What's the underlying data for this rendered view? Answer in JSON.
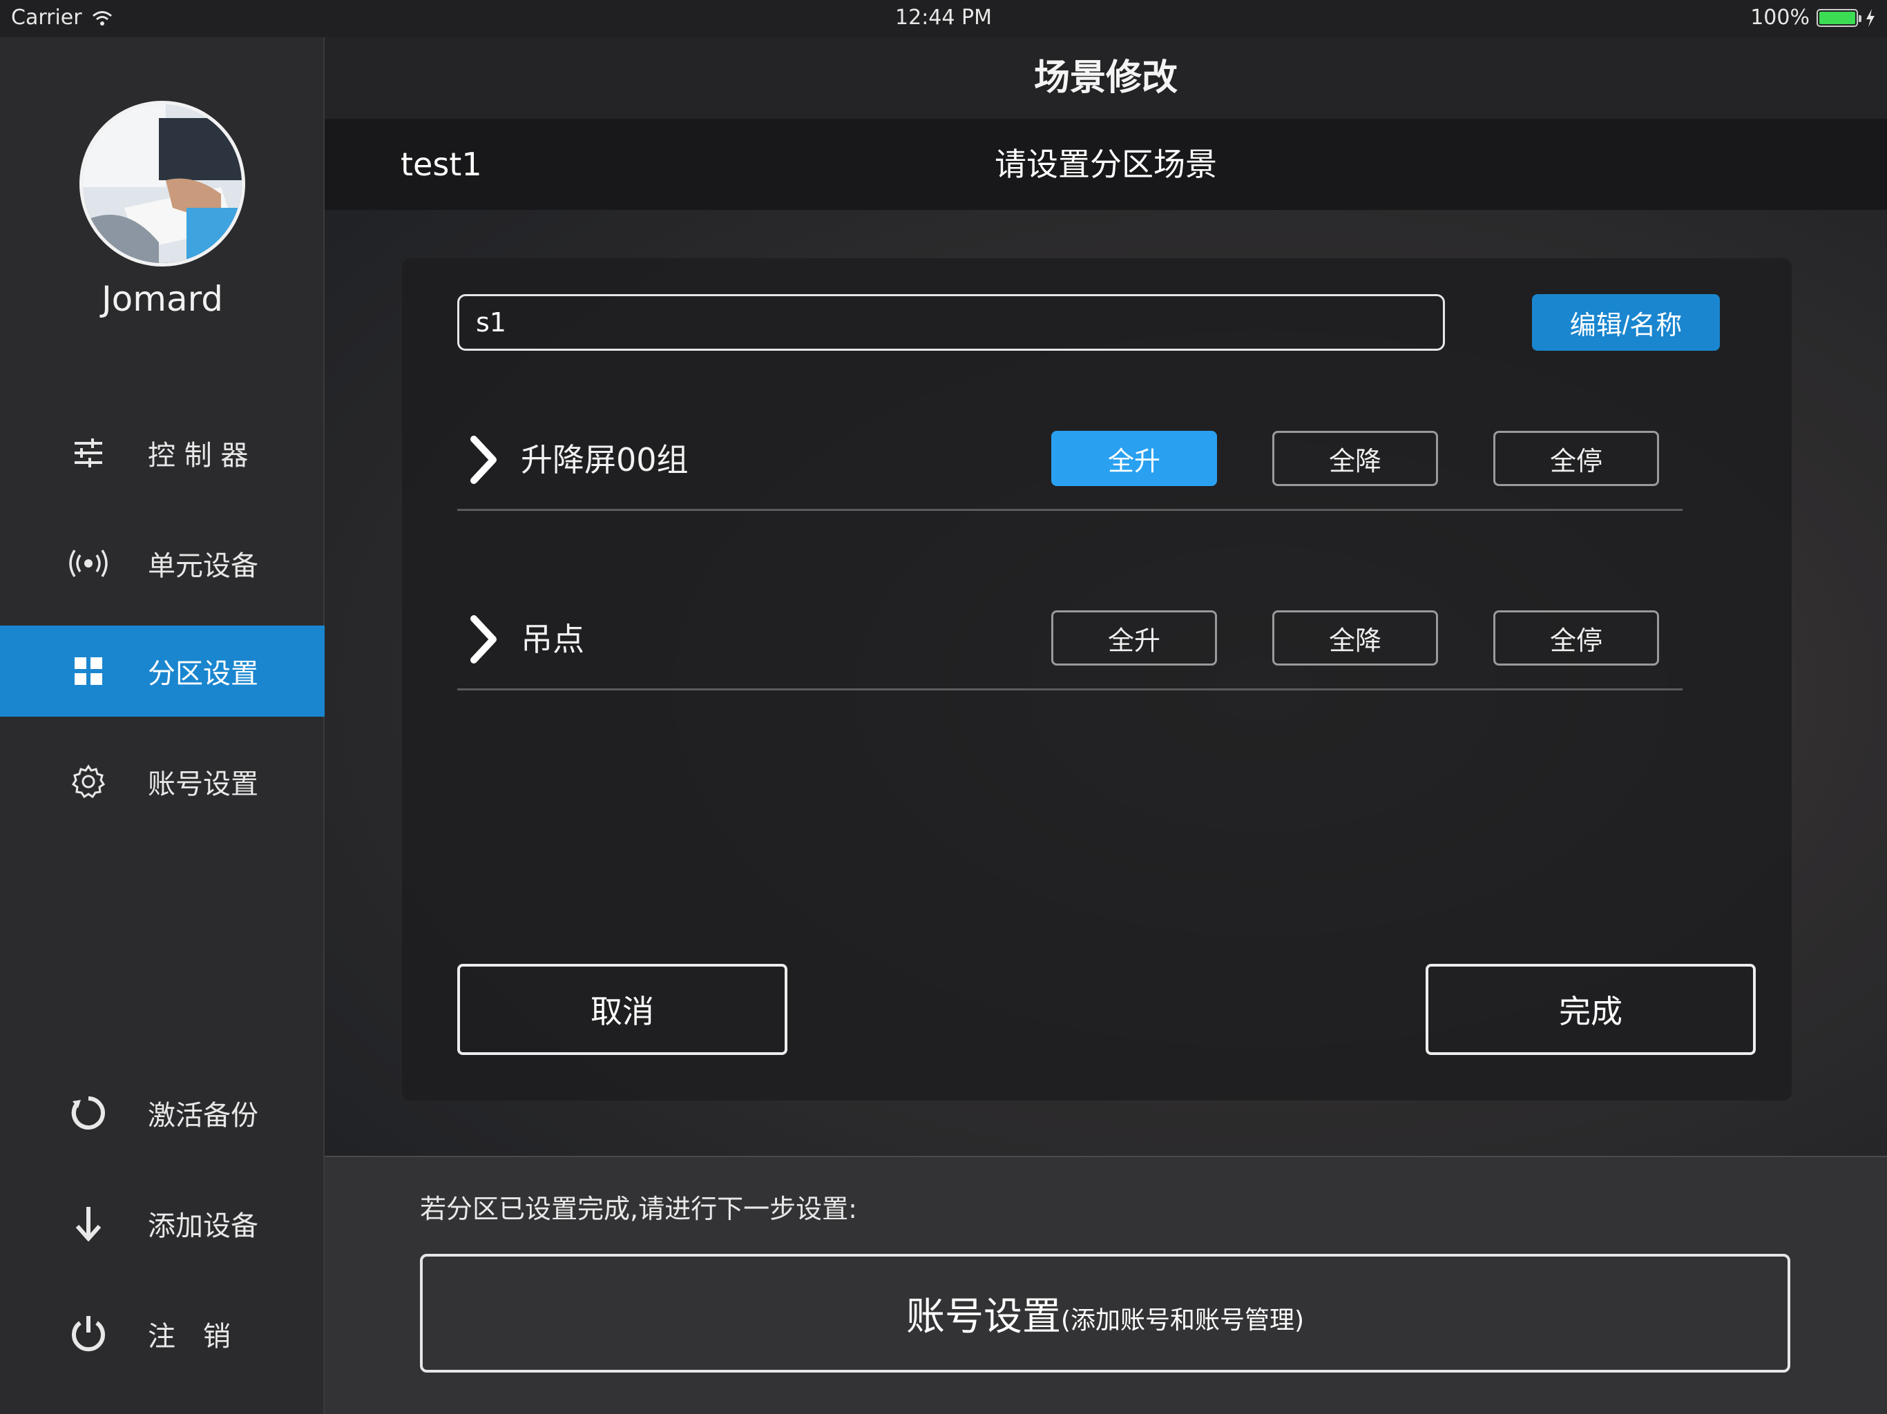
{
  "status_bar": {
    "carrier": "Carrier",
    "time": "12:44 PM",
    "battery": "100%"
  },
  "sidebar": {
    "username": "Jomard",
    "items": [
      {
        "label": "控 制 器",
        "icon": "sliders-icon",
        "active": false
      },
      {
        "label": "单元设备",
        "icon": "broadcast-icon",
        "active": false
      },
      {
        "label": "分区设置",
        "icon": "grid-icon",
        "active": true
      },
      {
        "label": "账号设置",
        "icon": "gear-icon",
        "active": false
      },
      {
        "label": "激活备份",
        "icon": "refresh-icon",
        "active": false
      },
      {
        "label": "添加设备",
        "icon": "arrow-down-icon",
        "active": false
      },
      {
        "label": "注　销",
        "icon": "power-icon",
        "active": false
      }
    ]
  },
  "header": {
    "title": "场景修改"
  },
  "subheader": {
    "scene": "test1",
    "hint": "请设置分区场景"
  },
  "panel": {
    "name_input_value": "s1",
    "edit_name_label": "编辑/名称",
    "groups": [
      {
        "name": "升降屏00组",
        "actions": [
          "全升",
          "全降",
          "全停"
        ],
        "selected": "全升"
      },
      {
        "name": "吊点",
        "actions": [
          "全升",
          "全降",
          "全停"
        ],
        "selected": null
      }
    ],
    "cancel_label": "取消",
    "done_label": "完成"
  },
  "footer": {
    "note": "若分区已设置完成,请进行下一步设置:",
    "account_main": "账号设置",
    "account_sub": "(添加账号和账号管理)"
  },
  "colors": {
    "accent": "#1a86cf",
    "selected_button": "#2aa1f0",
    "battery": "#3ddc55"
  }
}
